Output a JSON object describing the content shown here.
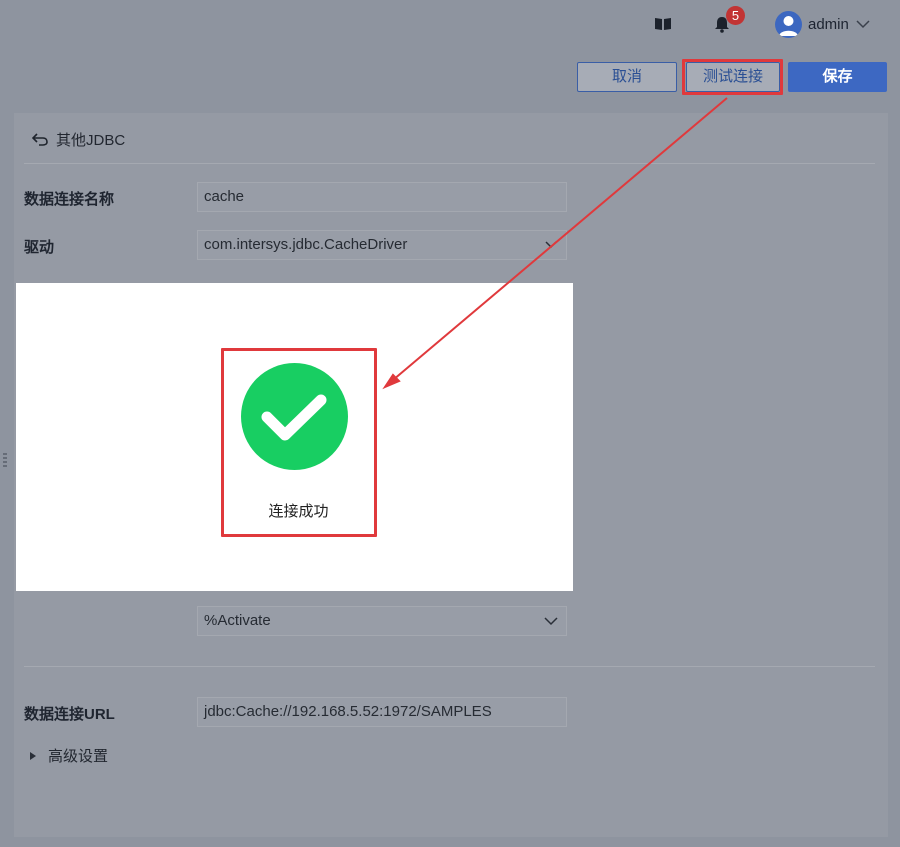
{
  "header": {
    "notification_count": "5",
    "user_name": "admin"
  },
  "actions": {
    "cancel_label": "取消",
    "test_label": "测试连接",
    "save_label": "保存"
  },
  "breadcrumb": {
    "back_label": "其他JDBC"
  },
  "form": {
    "connection_name_label": "数据连接名称",
    "connection_name_value": "cache",
    "driver_label": "驱动",
    "driver_value": "com.intersys.jdbc.CacheDriver",
    "role_value": "%Activate",
    "url_label": "数据连接URL",
    "url_value": "jdbc:Cache://192.168.5.52:1972/SAMPLES",
    "advanced_label": "高级设置"
  },
  "dialog": {
    "message": "连接成功"
  },
  "colors": {
    "primary": "#3d68c2",
    "success": "#18ce62",
    "highlight": "#e0393c",
    "badge": "#c23434"
  },
  "icons": {
    "book": "book-icon",
    "bell": "bell-icon",
    "avatar": "user-icon",
    "back": "undo-arrow-icon",
    "success": "check-icon"
  }
}
